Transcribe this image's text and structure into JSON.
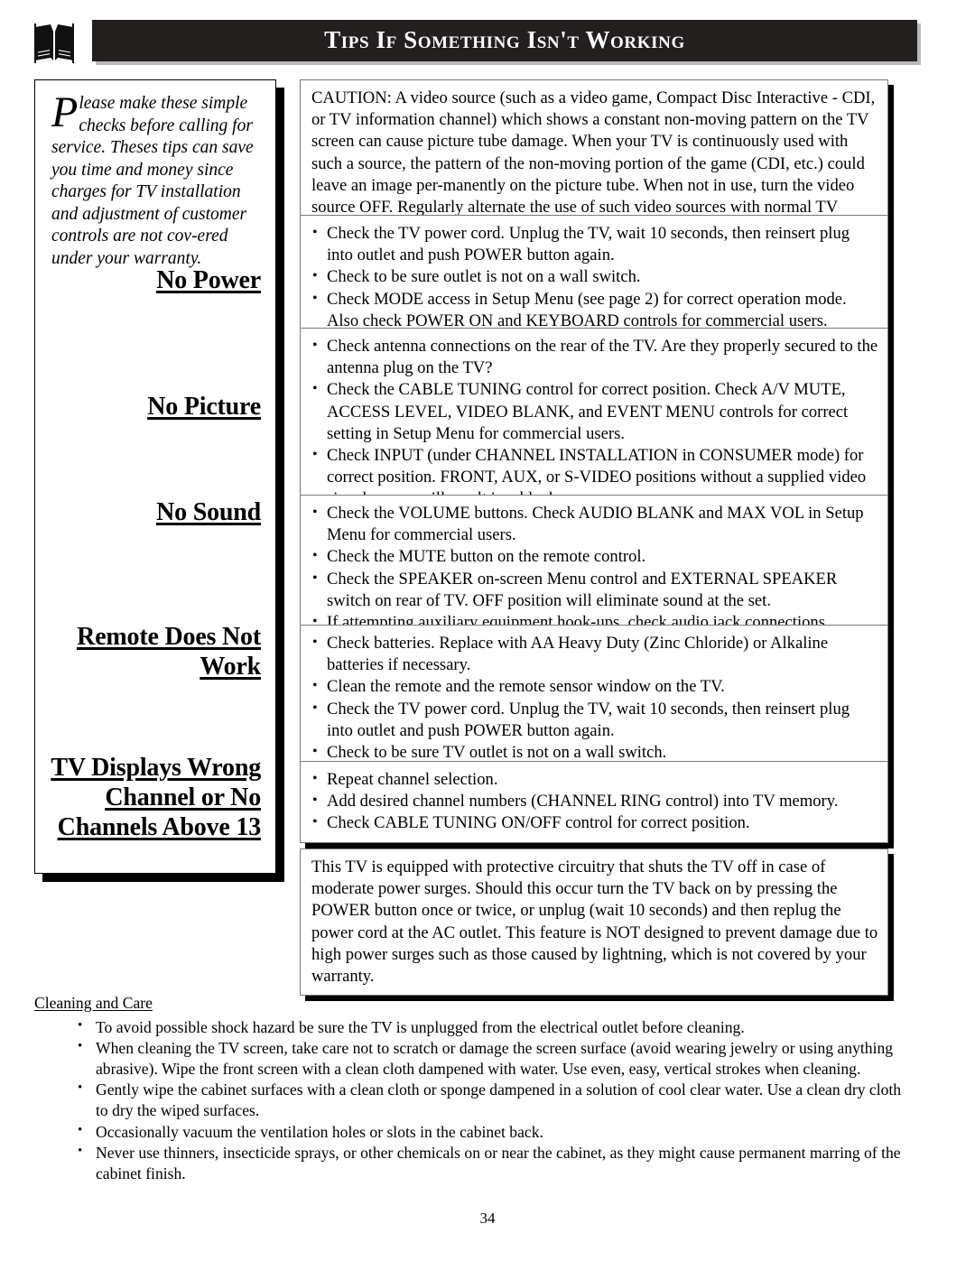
{
  "header": {
    "title": "Tips If Something Isn't Working",
    "icon": "open-book-icon",
    "bar_color": "#231f1e"
  },
  "sidebar": {
    "intro": {
      "dropcap": "P",
      "text": "lease make these simple checks before calling for service.  Theses tips can save you time and money since charges for TV installation and adjustment of customer controls are not cov-ered under your warranty."
    },
    "headings": [
      {
        "id": "no-power",
        "label": "No Power"
      },
      {
        "id": "no-picture",
        "label": "No Picture"
      },
      {
        "id": "no-sound",
        "label": "No Sound"
      },
      {
        "id": "remote-does-not-work",
        "label": "Remote Does Not Work"
      },
      {
        "id": "tv-displays-wrong-channel",
        "label": "TV Displays Wrong Channel or No Channels Above 13"
      }
    ]
  },
  "boxes": {
    "caution": {
      "text": "CAUTION: A video source (such as a video game, Compact Disc Interactive - CDI, or TV information channel) which shows a constant non-moving pattern on the TV screen can cause picture tube damage.  When your TV is continuously used with such a source, the pattern of the non-moving portion of the game (CDI, etc.) could leave an image per-manently on the picture tube.  When not in use, turn the video source OFF.  Regularly alternate the use of such video sources with normal TV viewing."
    },
    "no_power": {
      "items": [
        "Check the TV power cord.  Unplug the TV, wait 10 seconds, then reinsert plug into outlet and push POWER button again.",
        "Check to be sure outlet is not on a wall switch.",
        "Check MODE access in Setup Menu (see page 2) for correct operation mode. Also check POWER ON and KEYBOARD controls for commercial users."
      ]
    },
    "no_picture": {
      "items": [
        "Check antenna connections on the rear of the TV.  Are they properly secured to the antenna plug on the TV?",
        "Check the CABLE TUNING control for correct position. Check A/V MUTE, ACCESS LEVEL, VIDEO BLANK, and EVENT MENU controls for correct setting in Setup Menu for commercial users.",
        "Check INPUT (under CHANNEL INSTALLATION in CONSUMER mode) for correct position. FRONT, AUX, or S-VIDEO positions without a supplied video signal source will result in a blank screen."
      ]
    },
    "no_sound": {
      "items": [
        "Check the VOLUME buttons. Check AUDIO BLANK and MAX VOL in Setup Menu for commercial users.",
        "Check the MUTE button on the remote control.",
        "Check the SPEAKER on-screen Menu control and EXTERNAL SPEAKER switch on rear of TV. OFF position will eliminate sound at the set.",
        "If attempting auxiliary equipment hook-ups, check audio jack connections."
      ]
    },
    "remote": {
      "items": [
        "Check batteries.  Replace with AA Heavy Duty (Zinc Chloride) or Alkaline batteries if necessary.",
        "Clean the remote and the remote sensor window on the TV.",
        "Check the TV power cord.  Unplug the TV, wait 10 seconds, then reinsert plug into outlet and push POWER button again.",
        "Check to be sure TV outlet is not on a wall switch."
      ]
    },
    "channel": {
      "items": [
        "Repeat channel selection.",
        "Add desired channel numbers (CHANNEL RING control) into TV memory.",
        "Check CABLE TUNING ON/OFF control for correct position."
      ]
    },
    "surge": {
      "text": "This TV is equipped with protective circuitry that shuts the TV off in case of moderate power surges.  Should this occur turn the TV back on by pressing the POWER button once or twice, or unplug (wait 10 seconds) and then replug the power cord at the AC outlet. This feature is NOT designed to prevent damage due to high power surges such as those caused by lightning, which is not covered by your warranty."
    }
  },
  "cleaning": {
    "heading": "Cleaning and Care",
    "items": [
      "To avoid possible shock hazard be sure the TV is unplugged from the electrical outlet before cleaning.",
      "When cleaning the TV screen, take care not to scratch or damage the screen surface (avoid wearing jewelry or using anything abrasive).  Wipe the front screen with a clean cloth dampened with water.  Use even, easy, vertical strokes when cleaning.",
      "Gently wipe the cabinet surfaces with a clean cloth or sponge dampened in a solution of cool clear water.  Use a clean dry cloth to dry the wiped surfaces.",
      "Occasionally vacuum the ventilation holes or slots in the cabinet back.",
      "Never use thinners, insecticide sprays, or other chemicals on or near the cabinet, as they might cause permanent marring of the cabinet finish."
    ]
  },
  "footer": {
    "page_number": "34"
  }
}
